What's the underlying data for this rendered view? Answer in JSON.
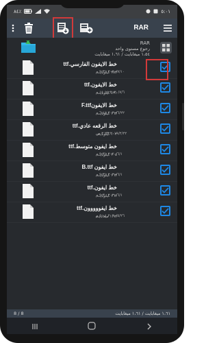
{
  "status_bar": {
    "time": "٥:٠١",
    "battery": "٨٤٪"
  },
  "toolbar": {
    "title": "RAR"
  },
  "path_row": {
    "path": "RAR",
    "up_label": "رجوع مستوى واحد",
    "summary": "١،٥٤ ميغابايت / ١،٦١ ميغابايت"
  },
  "files": [
    {
      "name": "خط الايفون الفارسي.ttf",
      "size": "٢٨٣ كيلوبايت",
      "date": "٢٠٢٠/٧/١٠ ٩:٣١ م",
      "highlighted": true
    },
    {
      "name": "خط الايفون.ttf",
      "size": "٤٣١ كيلوبايت",
      "date": "٢٠٢٠/٧/٦ ١١:١٤ م",
      "highlighted": false
    },
    {
      "name": "خط الايفونF.ttf",
      "size": "١٦٣ كيلوبايت",
      "date": "٢٠٢٠/٦/٢٢ ٦:٤٤ م",
      "highlighted": false
    },
    {
      "name": "خط الرقعه عادي.ttf",
      "size": "١٠٢ كيلوبايت",
      "date": "٢٠١٩/٢/٢٢ ٢:٢٣ ص",
      "highlighted": false
    },
    {
      "name": "خط ايفون متوسط.ttf",
      "size": "٢٠٤ كيلوبايت",
      "date": "٢٠٢٠/٦/١ ٩:٣١ م",
      "highlighted": false
    },
    {
      "name": "خط ايفون B.ttf",
      "size": "١٦٣ كيلوبايت",
      "date": "٢٠٢٠/٦/١ ٩:٣١ م",
      "highlighted": false
    },
    {
      "name": "خط ايفون.ttf",
      "size": "١٦٢ كيلوبايت",
      "date": "٢٠٢٠/٦/١ ٩:٣٠ م",
      "highlighted": false
    },
    {
      "name": "خط ايفووووون.ttf",
      "size": "١،٩٢ ميغابايت",
      "date": "٢٠٢٠/٥/٢٦ ٥:٠٤ م",
      "highlighted": false
    }
  ],
  "bottom": {
    "count": "8 / 8",
    "size": "١،٦١ ميغابايت / ١،٦١ ميغابايت"
  },
  "colors": {
    "toolbar_bg": "#39424d",
    "list_bg": "#272a2e",
    "check_blue": "#1e88e5",
    "highlight_red": "#d23a3a"
  }
}
